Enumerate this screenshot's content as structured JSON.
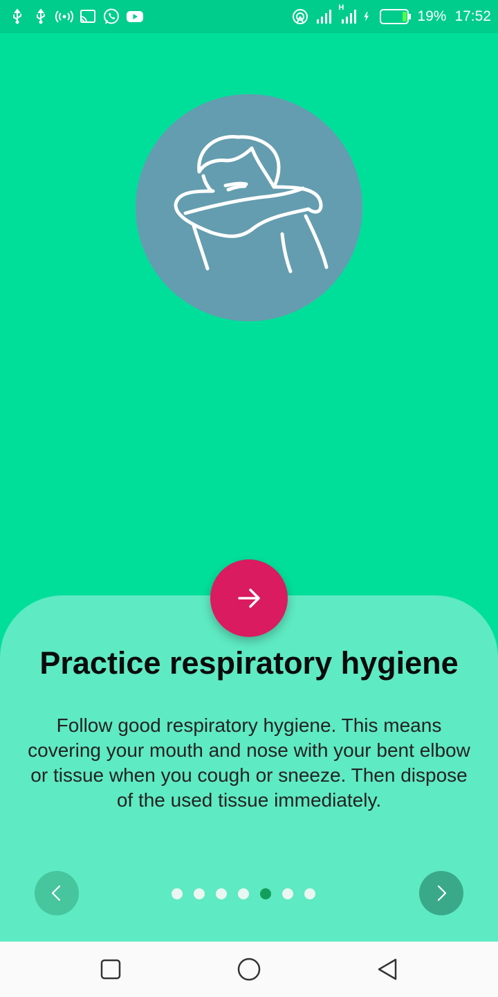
{
  "status_bar": {
    "battery_percent": "19%",
    "time": "17:52",
    "network_label": "H",
    "left_icons": [
      "usb-icon",
      "usb-icon",
      "hotspot-icon",
      "cast-icon",
      "whatsapp-icon",
      "youtube-icon"
    ],
    "right_icons": [
      "wireless-icon",
      "signal-icon",
      "signal-icon",
      "charging-icon",
      "battery-icon"
    ]
  },
  "hero": {
    "icon": "person-coughing-into-elbow-icon",
    "circle_color": "#649daf"
  },
  "next_action": {
    "icon": "arrow-right-icon",
    "color": "#da1b60"
  },
  "content": {
    "title": "Practice respiratory hygiene",
    "description": "Follow good respiratory hygiene. This means covering your mouth and nose with your bent elbow or tissue when you cough or sneeze. Then dispose of the used tissue immediately."
  },
  "pager": {
    "page_count": 7,
    "active_page": 5,
    "prev_icon": "chevron-left-icon",
    "next_icon": "chevron-right-icon"
  },
  "nav_bar": {
    "icons": [
      "recent-apps-icon",
      "home-icon",
      "back-icon"
    ]
  },
  "colors": {
    "background": "#00df9a",
    "sheet": "#5eeac2",
    "accent": "#da1b60",
    "active_dot": "#149e5c"
  }
}
